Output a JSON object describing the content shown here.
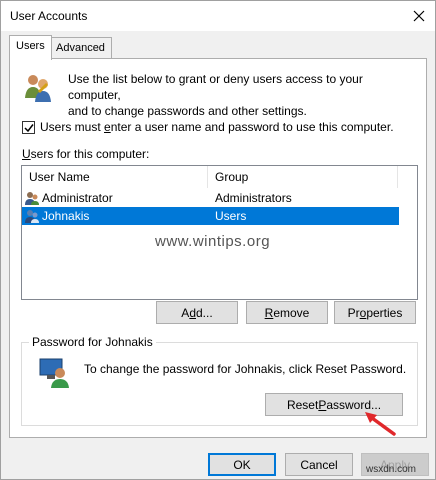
{
  "window": {
    "title": "User Accounts"
  },
  "tabs": [
    {
      "label": "Users"
    },
    {
      "label": "Advanced"
    }
  ],
  "intro": {
    "line1": "Use the list below to grant or deny users access to your computer,",
    "line2": "and to change passwords and other settings."
  },
  "checkbox": {
    "label_pre": "Users must ",
    "label_ul": "e",
    "label_post": "nter a user name and password to use this computer.",
    "checked": true
  },
  "users_list": {
    "label_ul": "U",
    "label_post": "sers for this computer:",
    "columns": [
      "User Name",
      "Group"
    ],
    "rows": [
      {
        "name": "Administrator",
        "group": "Administrators"
      },
      {
        "name": "Johnakis",
        "group": "Users",
        "selected": true
      }
    ]
  },
  "buttons": {
    "add": {
      "pre": "A",
      "ul": "d",
      "post": "d..."
    },
    "remove": {
      "ul": "R",
      "post": "emove"
    },
    "properties": {
      "pre": "Pr",
      "ul": "o",
      "post": "perties"
    }
  },
  "password_group": {
    "title": "Password for Johnakis",
    "text": "To change the password for Johnakis, click Reset Password.",
    "reset": {
      "pre": "Reset ",
      "ul": "P",
      "post": "assword..."
    }
  },
  "dialog_buttons": {
    "ok": "OK",
    "cancel": "Cancel",
    "apply": "Apply"
  },
  "watermark": "www.wintips.org",
  "corner_watermark": "wsxdn.com",
  "colors": {
    "selection": "#0078d7",
    "arrow": "#e0282b"
  }
}
